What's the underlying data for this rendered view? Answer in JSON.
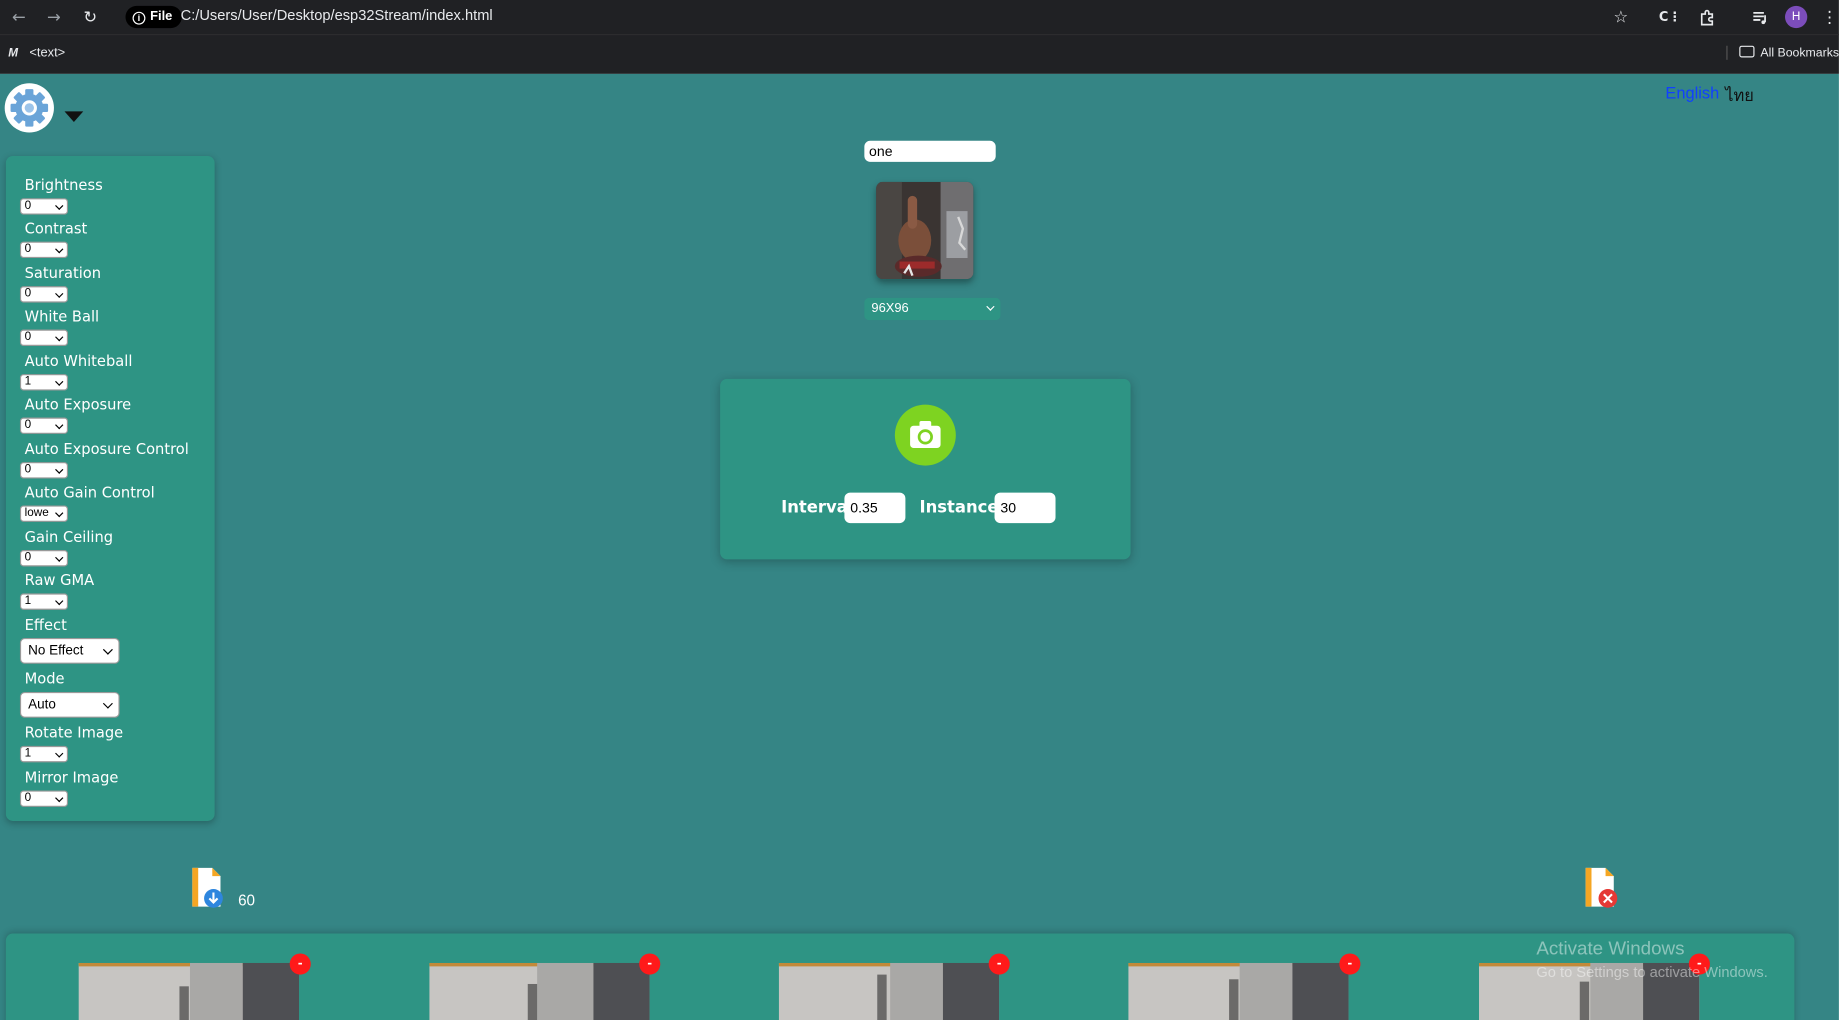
{
  "browser": {
    "file_label": "File",
    "url": "C:/Users/User/Desktop/esp32Stream/index.html",
    "profile_initial": "H",
    "bookmark_label": "<text>",
    "all_bookmarks_label": "All Bookmarks"
  },
  "languages": {
    "english": "English",
    "thai": "ไทย",
    "active": "English"
  },
  "settings": [
    {
      "label": "Brightness",
      "value": "0"
    },
    {
      "label": "Contrast",
      "value": "0"
    },
    {
      "label": "Saturation",
      "value": "0"
    },
    {
      "label": "White Ball",
      "value": "0"
    },
    {
      "label": "Auto Whiteball",
      "value": "1"
    },
    {
      "label": "Auto Exposure",
      "value": "0"
    },
    {
      "label": "Auto Exposure Control",
      "value": "0"
    },
    {
      "label": "Auto Gain Control",
      "value": "lowe"
    },
    {
      "label": "Gain Ceiling",
      "value": "0"
    },
    {
      "label": "Raw GMA",
      "value": "1"
    },
    {
      "label": "Effect",
      "value": "No Effect"
    },
    {
      "label": "Mode",
      "value": "Auto"
    },
    {
      "label": "Rotate Image",
      "value": "1"
    },
    {
      "label": "Mirror Image",
      "value": "0"
    }
  ],
  "camera": {
    "name_value": "one",
    "resolution": "96X96"
  },
  "capture": {
    "interval_label": "Interval",
    "interval_value": "0.35",
    "instances_label": "Instances",
    "instances_value": "30"
  },
  "downloads": {
    "count": "60"
  },
  "gallery": {
    "delete_label": "-",
    "thumbnails": 5
  },
  "watermark": {
    "line1": "Activate Windows",
    "line2": "Go to Settings to activate Windows."
  },
  "colors": {
    "page_bg": "#358585",
    "panel_bg": "#2e9484",
    "camera_button": "#7ed321",
    "delete_button": "#ff1a1a",
    "active_language": "#1040ff"
  }
}
